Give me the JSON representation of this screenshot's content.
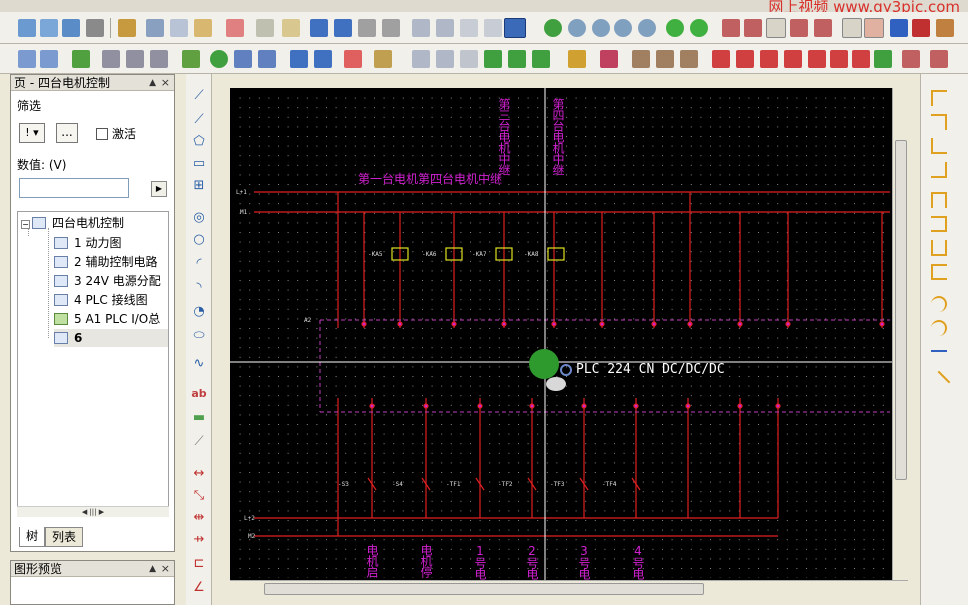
{
  "brand": "网上视频  www.gy3pic.com",
  "left_panel": {
    "title": "页 - 四台电机控制",
    "filter_label": "筛选",
    "filter_dropdown_value": "!",
    "filter_button": "...",
    "activate_label": "激活",
    "value_label": "数值: (V)",
    "value_input": "",
    "tree": {
      "root": "四台电机控制",
      "items": [
        {
          "label": "1 动力图"
        },
        {
          "label": "2 辅助控制电路"
        },
        {
          "label": "3 24V 电源分配"
        },
        {
          "label": "4 PLC 接线图"
        },
        {
          "label": "5 A1 PLC I/O总"
        },
        {
          "label": "6"
        }
      ]
    },
    "tabs": [
      "树",
      "列表"
    ]
  },
  "preview_panel": {
    "title": "图形预览"
  },
  "drawing": {
    "plc_label": "PLC 224 CN DC/DC/DC",
    "top_relay_label": "第一台电机第四台电机中继",
    "rail_labels": [
      "L+1",
      "M1",
      "A2",
      "L+2",
      "M2"
    ],
    "vertical_labels_top": [
      "第三台电机中继",
      "第四台电机中继"
    ],
    "coil_labels": [
      "-KA5",
      "-KA6",
      "-KA7",
      "-KA8"
    ],
    "switch_labels": [
      "-S3",
      "-S4",
      "-TF1",
      "-TF2",
      "-TF3",
      "-TF4"
    ],
    "bottom_labels": [
      "电机启",
      "电机停",
      "1号电",
      "2号电",
      "3号电",
      "4号电"
    ]
  },
  "colors": {
    "canvas_bg": "#000000",
    "rail": "#e02020",
    "magenta": "#d020d0",
    "grid_dot": "#8a8a8a",
    "cursor": "#ffffff"
  }
}
